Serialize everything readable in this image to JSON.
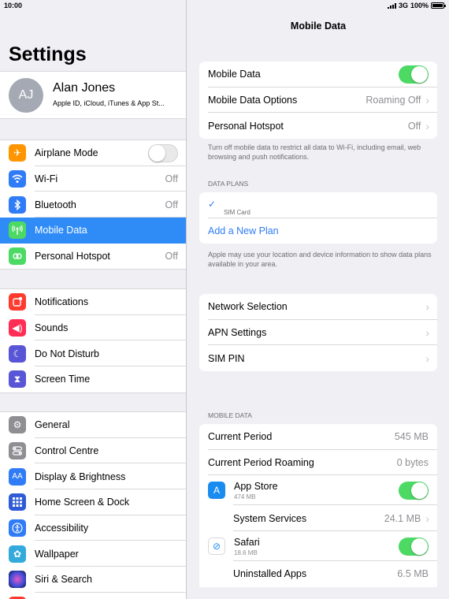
{
  "status": {
    "time": "10:00",
    "network": "3G",
    "battery": "100%"
  },
  "sidebar": {
    "title": "Settings",
    "profile": {
      "initials": "AJ",
      "name": "Alan Jones",
      "subtitle": "Apple ID, iCloud, iTunes & App St..."
    },
    "group1": [
      {
        "label": "Airplane Mode",
        "value": "",
        "icon": "airplane-icon",
        "color": "#ff9500",
        "toggle": "off"
      },
      {
        "label": "Wi-Fi",
        "value": "Off",
        "icon": "wifi-icon",
        "color": "#2f7cf6"
      },
      {
        "label": "Bluetooth",
        "value": "Off",
        "icon": "bluetooth-icon",
        "color": "#2f7cf6"
      },
      {
        "label": "Mobile Data",
        "value": "",
        "icon": "antenna-icon",
        "color": "#4cd964",
        "selected": true
      },
      {
        "label": "Personal Hotspot",
        "value": "Off",
        "icon": "hotspot-icon",
        "color": "#4cd964"
      }
    ],
    "group2": [
      {
        "label": "Notifications",
        "icon": "notifications-icon",
        "color": "#ff3b30"
      },
      {
        "label": "Sounds",
        "icon": "speaker-icon",
        "color": "#ff2d55"
      },
      {
        "label": "Do Not Disturb",
        "icon": "moon-icon",
        "color": "#5856d6"
      },
      {
        "label": "Screen Time",
        "icon": "hourglass-icon",
        "color": "#5856d6"
      }
    ],
    "group3": [
      {
        "label": "General",
        "icon": "gear-icon",
        "color": "#8e8e93"
      },
      {
        "label": "Control Centre",
        "icon": "switches-icon",
        "color": "#8e8e93"
      },
      {
        "label": "Display & Brightness",
        "icon": "aa-icon",
        "color": "#2f7cf6"
      },
      {
        "label": "Home Screen & Dock",
        "icon": "grid-icon",
        "color": "#2f5cd6"
      },
      {
        "label": "Accessibility",
        "icon": "accessibility-icon",
        "color": "#2f7cf6"
      },
      {
        "label": "Wallpaper",
        "icon": "flower-icon",
        "color": "#34aadc"
      },
      {
        "label": "Siri & Search",
        "icon": "siri-icon",
        "color": "#222222"
      }
    ]
  },
  "detail": {
    "title": "Mobile Data",
    "card1": {
      "mobile_data_label": "Mobile Data",
      "options_label": "Mobile Data Options",
      "options_value": "Roaming Off",
      "hotspot_label": "Personal Hotspot",
      "hotspot_value": "Off"
    },
    "footnote1": "Turn off mobile data to restrict all data to Wi-Fi, including email, web browsing and push notifications.",
    "data_plans_header": "DATA PLANS",
    "sim_card_label": "SIM Card",
    "add_plan_label": "Add a New Plan",
    "footnote2": "Apple may use your location and device information to show data plans available in your area.",
    "card3": {
      "network_label": "Network Selection",
      "apn_label": "APN Settings",
      "simpin_label": "SIM PIN"
    },
    "mobile_data_header": "MOBILE DATA",
    "usage": {
      "current_period_label": "Current Period",
      "current_period_value": "545 MB",
      "roaming_label": "Current Period Roaming",
      "roaming_value": "0 bytes",
      "appstore_label": "App Store",
      "appstore_size": "474 MB",
      "system_label": "System Services",
      "system_value": "24.1 MB",
      "safari_label": "Safari",
      "safari_size": "18.6 MB",
      "uninstalled_label": "Uninstalled Apps",
      "uninstalled_value": "6.5 MB"
    }
  }
}
